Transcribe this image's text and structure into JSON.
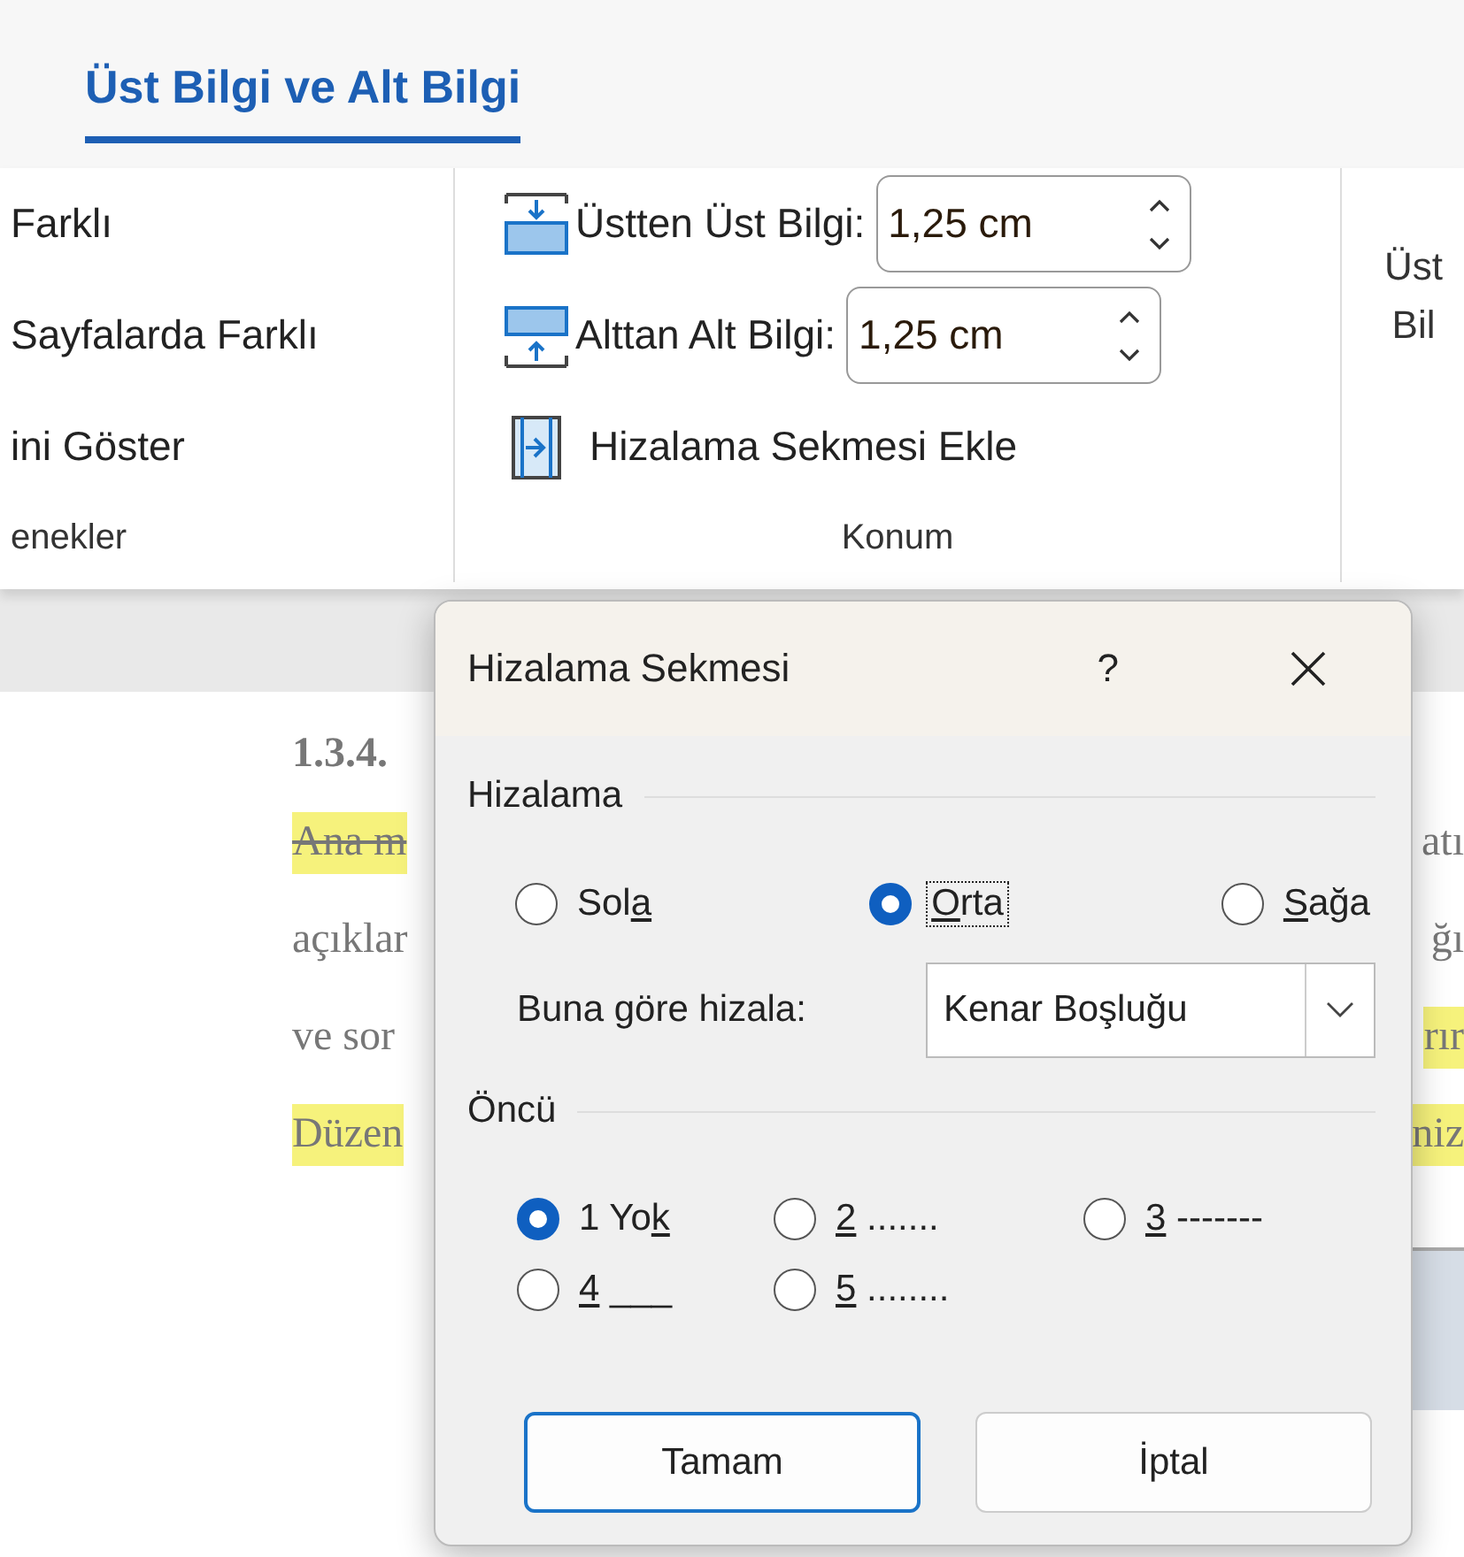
{
  "tab": {
    "label": "Üst Bilgi ve Alt Bilgi",
    "selected": true
  },
  "ribbon_groups": [
    {
      "label": "enekler",
      "items": [
        {
          "kind": "text",
          "label": "Farklı"
        },
        {
          "kind": "text",
          "label": "Sayfalarda Farklı"
        },
        {
          "kind": "text",
          "label": "ini Göster"
        }
      ]
    },
    {
      "label": "Konum",
      "items": [
        {
          "kind": "spinner_top",
          "label": "Üstten Üst Bilgi:",
          "value": "1,25 cm"
        },
        {
          "kind": "spinner_bottom",
          "label": "Alttan Alt Bilgi:",
          "value": "1,25 cm"
        },
        {
          "kind": "tab_button",
          "label": "Hizalama Sekmesi Ekle"
        }
      ]
    },
    {
      "items": [
        {
          "kind": "large",
          "label_lines": [
            "Üst",
            "Bil"
          ]
        }
      ]
    }
  ],
  "document": {
    "heading": "1.3.4.",
    "lines": [
      {
        "left": "Ana m",
        "left_highlight": true,
        "left_strike": true,
        "right": "atı",
        "right_highlight": false
      },
      {
        "left": "açıklar",
        "left_highlight": false,
        "left_strike": false,
        "right": "ğı",
        "right_highlight": false
      },
      {
        "left": "ve sor",
        "left_highlight": false,
        "left_strike": false,
        "right": "rır",
        "right_highlight": true
      },
      {
        "left": "Düzen",
        "left_highlight": true,
        "left_strike": false,
        "right": "niz",
        "right_highlight": true
      }
    ]
  },
  "dialog": {
    "title": "Hizalama Sekmesi",
    "help": "?",
    "alignment": {
      "legend": "Hizalama",
      "options": [
        {
          "before": "Sol",
          "key": "a",
          "selected": false,
          "focused": false
        },
        {
          "key": "O",
          "after": "rta",
          "selected": true,
          "focused": true
        },
        {
          "key": "S",
          "after": "ağa",
          "selected": false,
          "focused": false
        }
      ],
      "relative_label": "Buna göre hizala:",
      "relative_value": "Kenar Boşluğu"
    },
    "leader": {
      "legend": "Öncü",
      "options": [
        {
          "before": "1 Yo",
          "key": "k",
          "selected": true
        },
        {
          "key": "2",
          "after": " .......",
          "selected": false
        },
        {
          "key": "3",
          "after": " -------",
          "selected": false
        },
        {
          "key": "4",
          "after": " ___",
          "selected": false
        },
        {
          "key": "5",
          "after": " ........",
          "selected": false
        }
      ]
    },
    "buttons": [
      {
        "label": "Tamam",
        "default": true
      },
      {
        "label": "İptal",
        "default": false
      }
    ]
  }
}
